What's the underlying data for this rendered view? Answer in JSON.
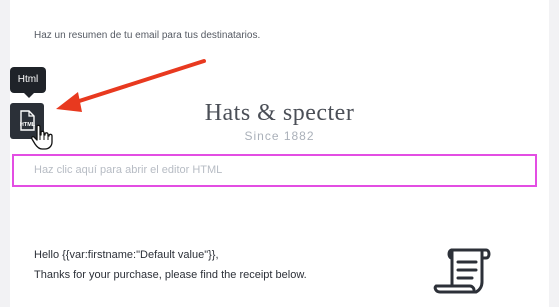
{
  "summary_text": "Haz un resumen de tu email para tus destinatarios.",
  "tooltip": {
    "label": "Html"
  },
  "html_tool": {
    "icon": "html-file-icon",
    "badge": "HTML"
  },
  "brand": {
    "name": "Hats & specter",
    "since": "Since 1882"
  },
  "html_editor": {
    "placeholder": "Haz clic aquí para abrir el editor HTML"
  },
  "greeting": {
    "line1": "Hello {{var:firstname:\"Default value\"}},",
    "line2": "Thanks for your purchase, please find the receipt below."
  },
  "colors": {
    "highlight": "#e34ee3",
    "arrow": "#e8391f",
    "tool_bg": "#2b3038"
  },
  "icons": [
    "html-file-icon",
    "hand-cursor-icon",
    "receipt-scroll-icon",
    "red-arrow-icon"
  ]
}
